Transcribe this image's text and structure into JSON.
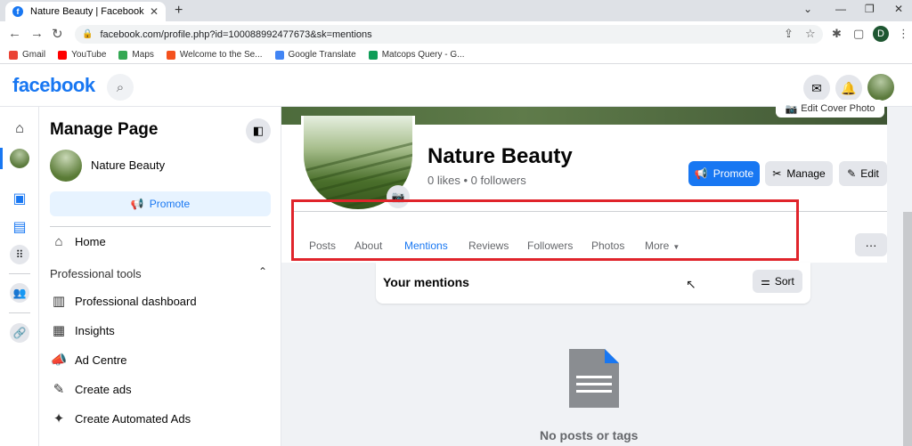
{
  "browser": {
    "tab_title": "Nature Beauty | Facebook",
    "tab_close": "✕",
    "new_tab": "+",
    "url": "facebook.com/profile.php?id=100088992477673&sk=mentions",
    "profile_initial": "D",
    "bookmarks": [
      {
        "label": "Gmail",
        "color": "#ea4335"
      },
      {
        "label": "YouTube",
        "color": "#ff0000"
      },
      {
        "label": "Maps",
        "color": "#34a853"
      },
      {
        "label": "Welcome to the Se...",
        "color": "#f4511e"
      },
      {
        "label": "Google Translate",
        "color": "#4285f4"
      },
      {
        "label": "Matcops Query - G...",
        "color": "#0f9d58"
      }
    ]
  },
  "fb": {
    "logo": "facebook"
  },
  "sidebar": {
    "title": "Manage Page",
    "page_name": "Nature Beauty",
    "promote_label": "Promote",
    "section_title": "Professional tools",
    "items": [
      {
        "label": "Home"
      },
      {
        "label": "Professional dashboard"
      },
      {
        "label": "Insights"
      },
      {
        "label": "Ad Centre"
      },
      {
        "label": "Create ads"
      },
      {
        "label": "Create Automated Ads"
      }
    ]
  },
  "header": {
    "cover_button": "Edit Cover Photo",
    "page_name": "Nature Beauty",
    "stats": "0 likes • 0 followers",
    "promote": "Promote",
    "manage": "Manage",
    "edit": "Edit",
    "more_dots": "···",
    "tabs": [
      {
        "label": "Posts"
      },
      {
        "label": "About"
      },
      {
        "label": "Mentions"
      },
      {
        "label": "Reviews"
      },
      {
        "label": "Followers"
      },
      {
        "label": "Photos"
      },
      {
        "label": "More"
      }
    ]
  },
  "mentions": {
    "title": "Your mentions",
    "sort": "Sort",
    "empty_text": "No posts or tags"
  },
  "colors": {
    "brand": "#1877f2",
    "highlight": "#e0242b"
  }
}
